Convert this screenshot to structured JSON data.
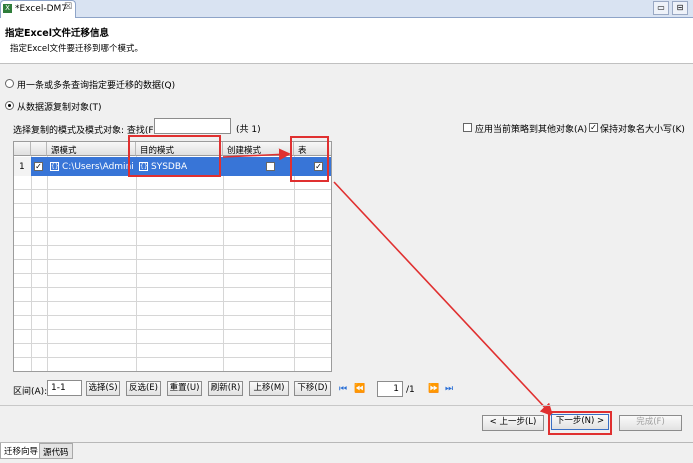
{
  "editor_tab": {
    "title": "*Excel-DM7",
    "close": "☒"
  },
  "window_controls": [
    "▭",
    "⊟"
  ],
  "header": {
    "title": "指定Excel文件迁移信息",
    "subtitle": "指定Excel文件要迁移到哪个模式。"
  },
  "options": {
    "query_label": "用一条或多条查询指定要迁移的数据(Q)",
    "copy_label": "从数据源复制对象(T)"
  },
  "filter": {
    "label": "选择复制的模式及模式对象: 查找(F):",
    "search_value": "",
    "count": "(共 1)",
    "apply_strategy_label": "应用当前策略到其他对象(A)",
    "keep_case_label": "保持对象名大小写(K)"
  },
  "grid": {
    "headers": [
      "源模式",
      "目的模式",
      "创建模式",
      "表"
    ],
    "rows": [
      {
        "num": "1",
        "source": "C:\\Users\\Admini",
        "target": "SYSDBA",
        "create": false,
        "table": true
      }
    ]
  },
  "toolbar": {
    "range_label": "区间(A):",
    "range_value": "1-1",
    "buttons": [
      "选择(S)",
      "反选(E)",
      "重置(U)",
      "刷新(R)",
      "上移(M)",
      "下移(D)"
    ],
    "page_value": "1",
    "page_total": "/1"
  },
  "footer": {
    "back": "< 上一步(L)",
    "next": "下一步(N) >",
    "finish": "完成(F)"
  },
  "bottom_tabs": [
    "迁移向导",
    "源代码"
  ],
  "colors": {
    "selection": "#3875d7",
    "highlight": "#e03030",
    "nav": "#2a6fd6"
  }
}
